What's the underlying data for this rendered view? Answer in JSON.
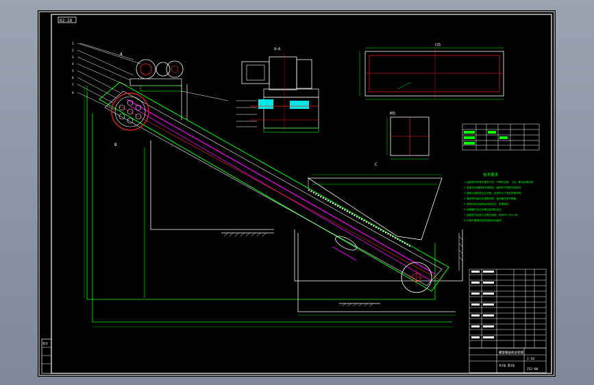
{
  "drawing": {
    "corner_tag": "02-10",
    "section_marks": [
      "A",
      "B",
      "C",
      "D",
      "E"
    ],
    "section_view_title": "A—A",
    "top_view_title": "C向",
    "small_view_title": "B向",
    "technical_requirements_title": "技术要求",
    "technical_requirements": [
      "1.装配前所有零件清洗干净，不得有毛刺、飞边、氧化皮等杂质。",
      "2.各密封件装配前须浸透油，装配时不得损伤密封件。",
      "3.链条与链轮啮合应平稳，运转时无卡滞及异常声响。",
      "4.输送带安装后应调整张紧，保证输送带不跑偏。",
      "5.各转动部位装配后转动灵活，润滑良好。",
      "6.减速器内加注润滑油至规定油位。",
      "7.装配完毕后进行空载试运转，时间不少于2小时。",
      "8.所有外露表面涂防锈底漆及面漆。"
    ],
    "title_block": {
      "drawing_name": "螺旋输送机总装图",
      "scale": "1:10",
      "sheet": "共1张 第1张",
      "code": "ZSJ-00"
    },
    "left_strip_label": "签字"
  },
  "colors": {
    "frame": "#ffffff",
    "outline": "#00ff00",
    "magenta": "#ff00ff",
    "red": "#ff2020",
    "cyan": "#00ffff",
    "yellow": "#ffff00"
  }
}
